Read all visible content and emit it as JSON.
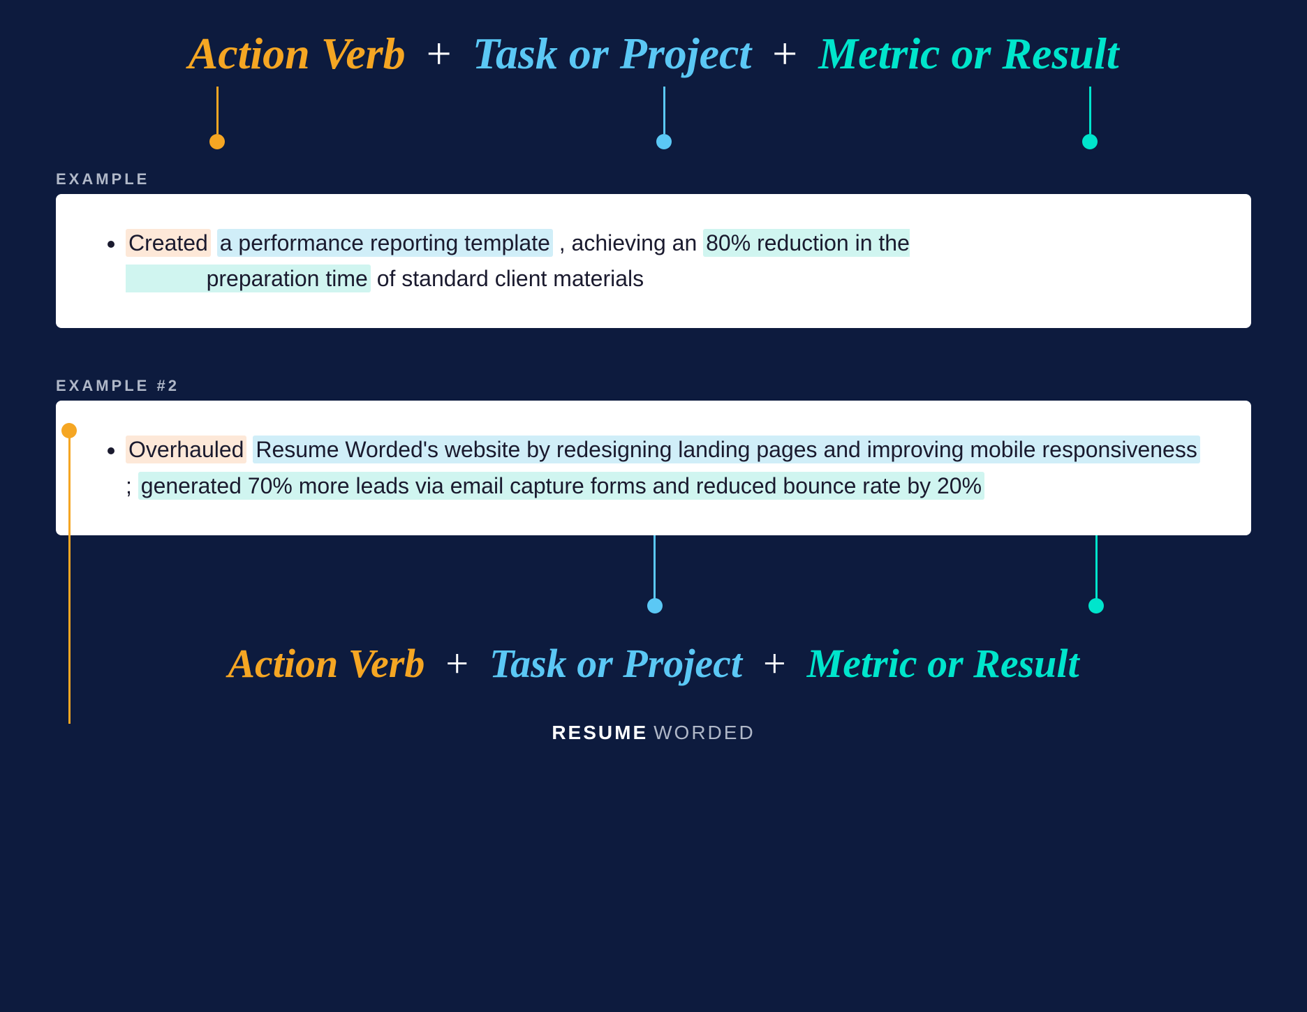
{
  "header": {
    "term_action": "Action Verb",
    "term_task": "Task or Project",
    "term_metric": "Metric or Result",
    "plus": "+"
  },
  "example1": {
    "label": "EXAMPLE",
    "text_plain_before": "Created",
    "text_span_orange": "Created",
    "text_span_blue": "a performance reporting template",
    "text_middle": ", achieving an",
    "text_span_teal": "80% reduction in the preparation time",
    "text_end": "of standard client materials",
    "full_text": "Created a performance reporting template, achieving an 80% reduction in the preparation time of standard client materials"
  },
  "example2": {
    "label": "EXAMPLE #2",
    "text_span_orange": "Overhauled",
    "text_span_blue": "Resume Worded's website by redesigning landing pages and improving mobile responsiveness",
    "text_semi": ";",
    "text_span_teal": "generated 70% more leads via email capture forms and reduced bounce rate by 20%",
    "full_text": "Overhauled Resume Worded's website by redesigning landing pages and improving mobile responsiveness; generated 70% more leads via email capture forms and reduced bounce rate by 20%"
  },
  "footer_formula": {
    "term_action": "Action Verb",
    "term_task": "Task or Project",
    "term_metric": "Metric or Result",
    "plus": "+"
  },
  "branding": {
    "resume": "RESUME",
    "worded": "WORDED"
  },
  "colors": {
    "orange": "#f5a623",
    "blue": "#5bc8f5",
    "teal": "#00e5cc",
    "bg": "#0d1b3e",
    "white": "#ffffff"
  }
}
